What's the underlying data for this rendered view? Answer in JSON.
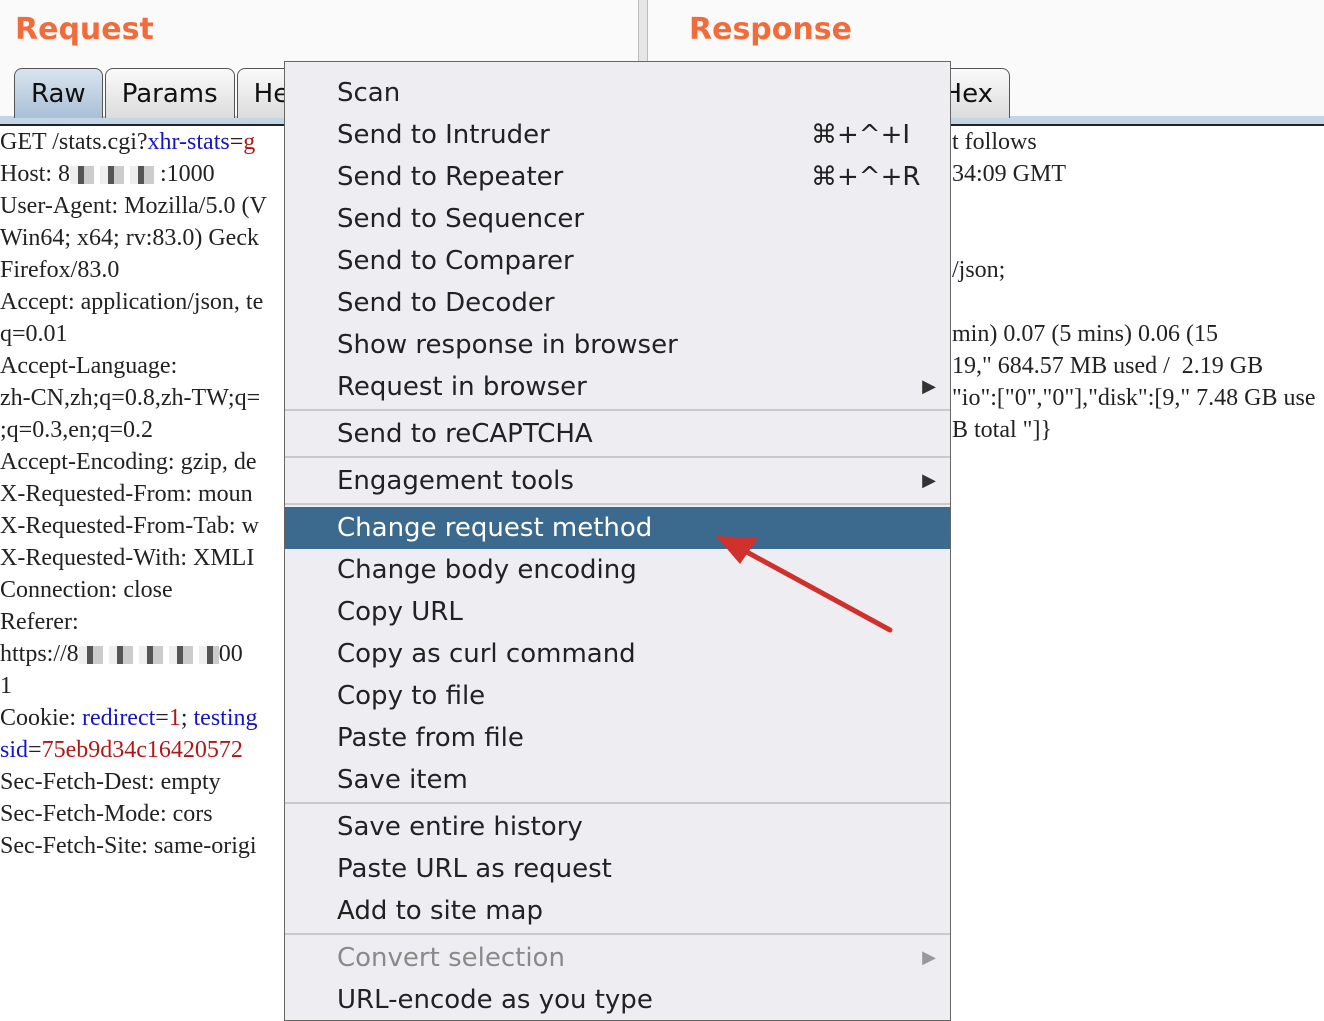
{
  "request": {
    "title": "Request",
    "tabs": [
      "Raw",
      "Params",
      "He"
    ],
    "lines": {
      "l1a": "GET /stats.cgi?",
      "l1k": "xhr-stats",
      "l1e": "=",
      "l1v": "g",
      "l2a": "Host: 8",
      "l2b": ":1000",
      "l3": "User-Agent: Mozilla/5.0 (V",
      "l4": "Win64; x64; rv:83.0) Geck",
      "l5": "Firefox/83.0",
      "l6": "Accept: application/json, te",
      "l7": "q=0.01",
      "l8": "Accept-Language:",
      "l9": "zh-CN,zh;q=0.8,zh-TW;q=",
      "l10": ";q=0.3,en;q=0.2",
      "l11": "Accept-Encoding: gzip, de",
      "l12": "X-Requested-From: moun",
      "l13": "X-Requested-From-Tab: w",
      "l14": "X-Requested-With: XMLI",
      "l15": "Connection: close",
      "l16": "Referer:",
      "l17a": "https://8",
      "l17b": "00",
      "l18": "1",
      "l19a": "Cookie: ",
      "l19k": "redirect",
      "l19e": "=",
      "l19v": "1",
      "l19b": "; ",
      "l19k2": "testing",
      "l20k": "sid",
      "l20e": "=",
      "l20v": "75eb9d34c16420572",
      "l21": "Sec-Fetch-Dest: empty",
      "l22": "Sec-Fetch-Mode: cors",
      "l23": "Sec-Fetch-Site: same-origi"
    }
  },
  "response": {
    "title": "Response",
    "tabs": [
      "Hex"
    ],
    "lines": [
      "t follows",
      "34:09 GMT",
      "",
      "",
      "/json;",
      "",
      "min) 0.07 (5 mins) 0.06 (15",
      "19,\" 684.57 MB used /  2.19 GB",
      "\"io\":[\"0\",\"0\"],\"disk\":[9,\" 7.48 GB use",
      "B total \"]}"
    ]
  },
  "menu": {
    "items": [
      {
        "label": "Scan"
      },
      {
        "label": "Send to Intruder",
        "shortcut": "⌘+^+I"
      },
      {
        "label": "Send to Repeater",
        "shortcut": "⌘+^+R"
      },
      {
        "label": "Send to Sequencer"
      },
      {
        "label": "Send to Comparer"
      },
      {
        "label": "Send to Decoder"
      },
      {
        "label": "Show response in browser"
      },
      {
        "label": "Request in browser",
        "submenu": "▶"
      },
      {
        "label": "Send to reCAPTCHA"
      },
      {
        "label": "Engagement tools",
        "submenu": "▶"
      },
      {
        "label": "Change request method"
      },
      {
        "label": "Change body encoding"
      },
      {
        "label": "Copy URL"
      },
      {
        "label": "Copy as curl command"
      },
      {
        "label": "Copy to file"
      },
      {
        "label": "Paste from file"
      },
      {
        "label": "Save item"
      },
      {
        "label": "Save entire history"
      },
      {
        "label": "Paste URL as request"
      },
      {
        "label": "Add to site map"
      },
      {
        "label": "Convert selection",
        "submenu": "▶"
      },
      {
        "label": "URL-encode as you type"
      }
    ],
    "highlighted": "Change request method",
    "disabled": "Convert selection"
  },
  "colors": {
    "title": "#f26b3a",
    "highlight": "#3b6a8e",
    "arrow": "#d0312d",
    "param_name": "#1515c8",
    "param_value": "#b01818"
  }
}
